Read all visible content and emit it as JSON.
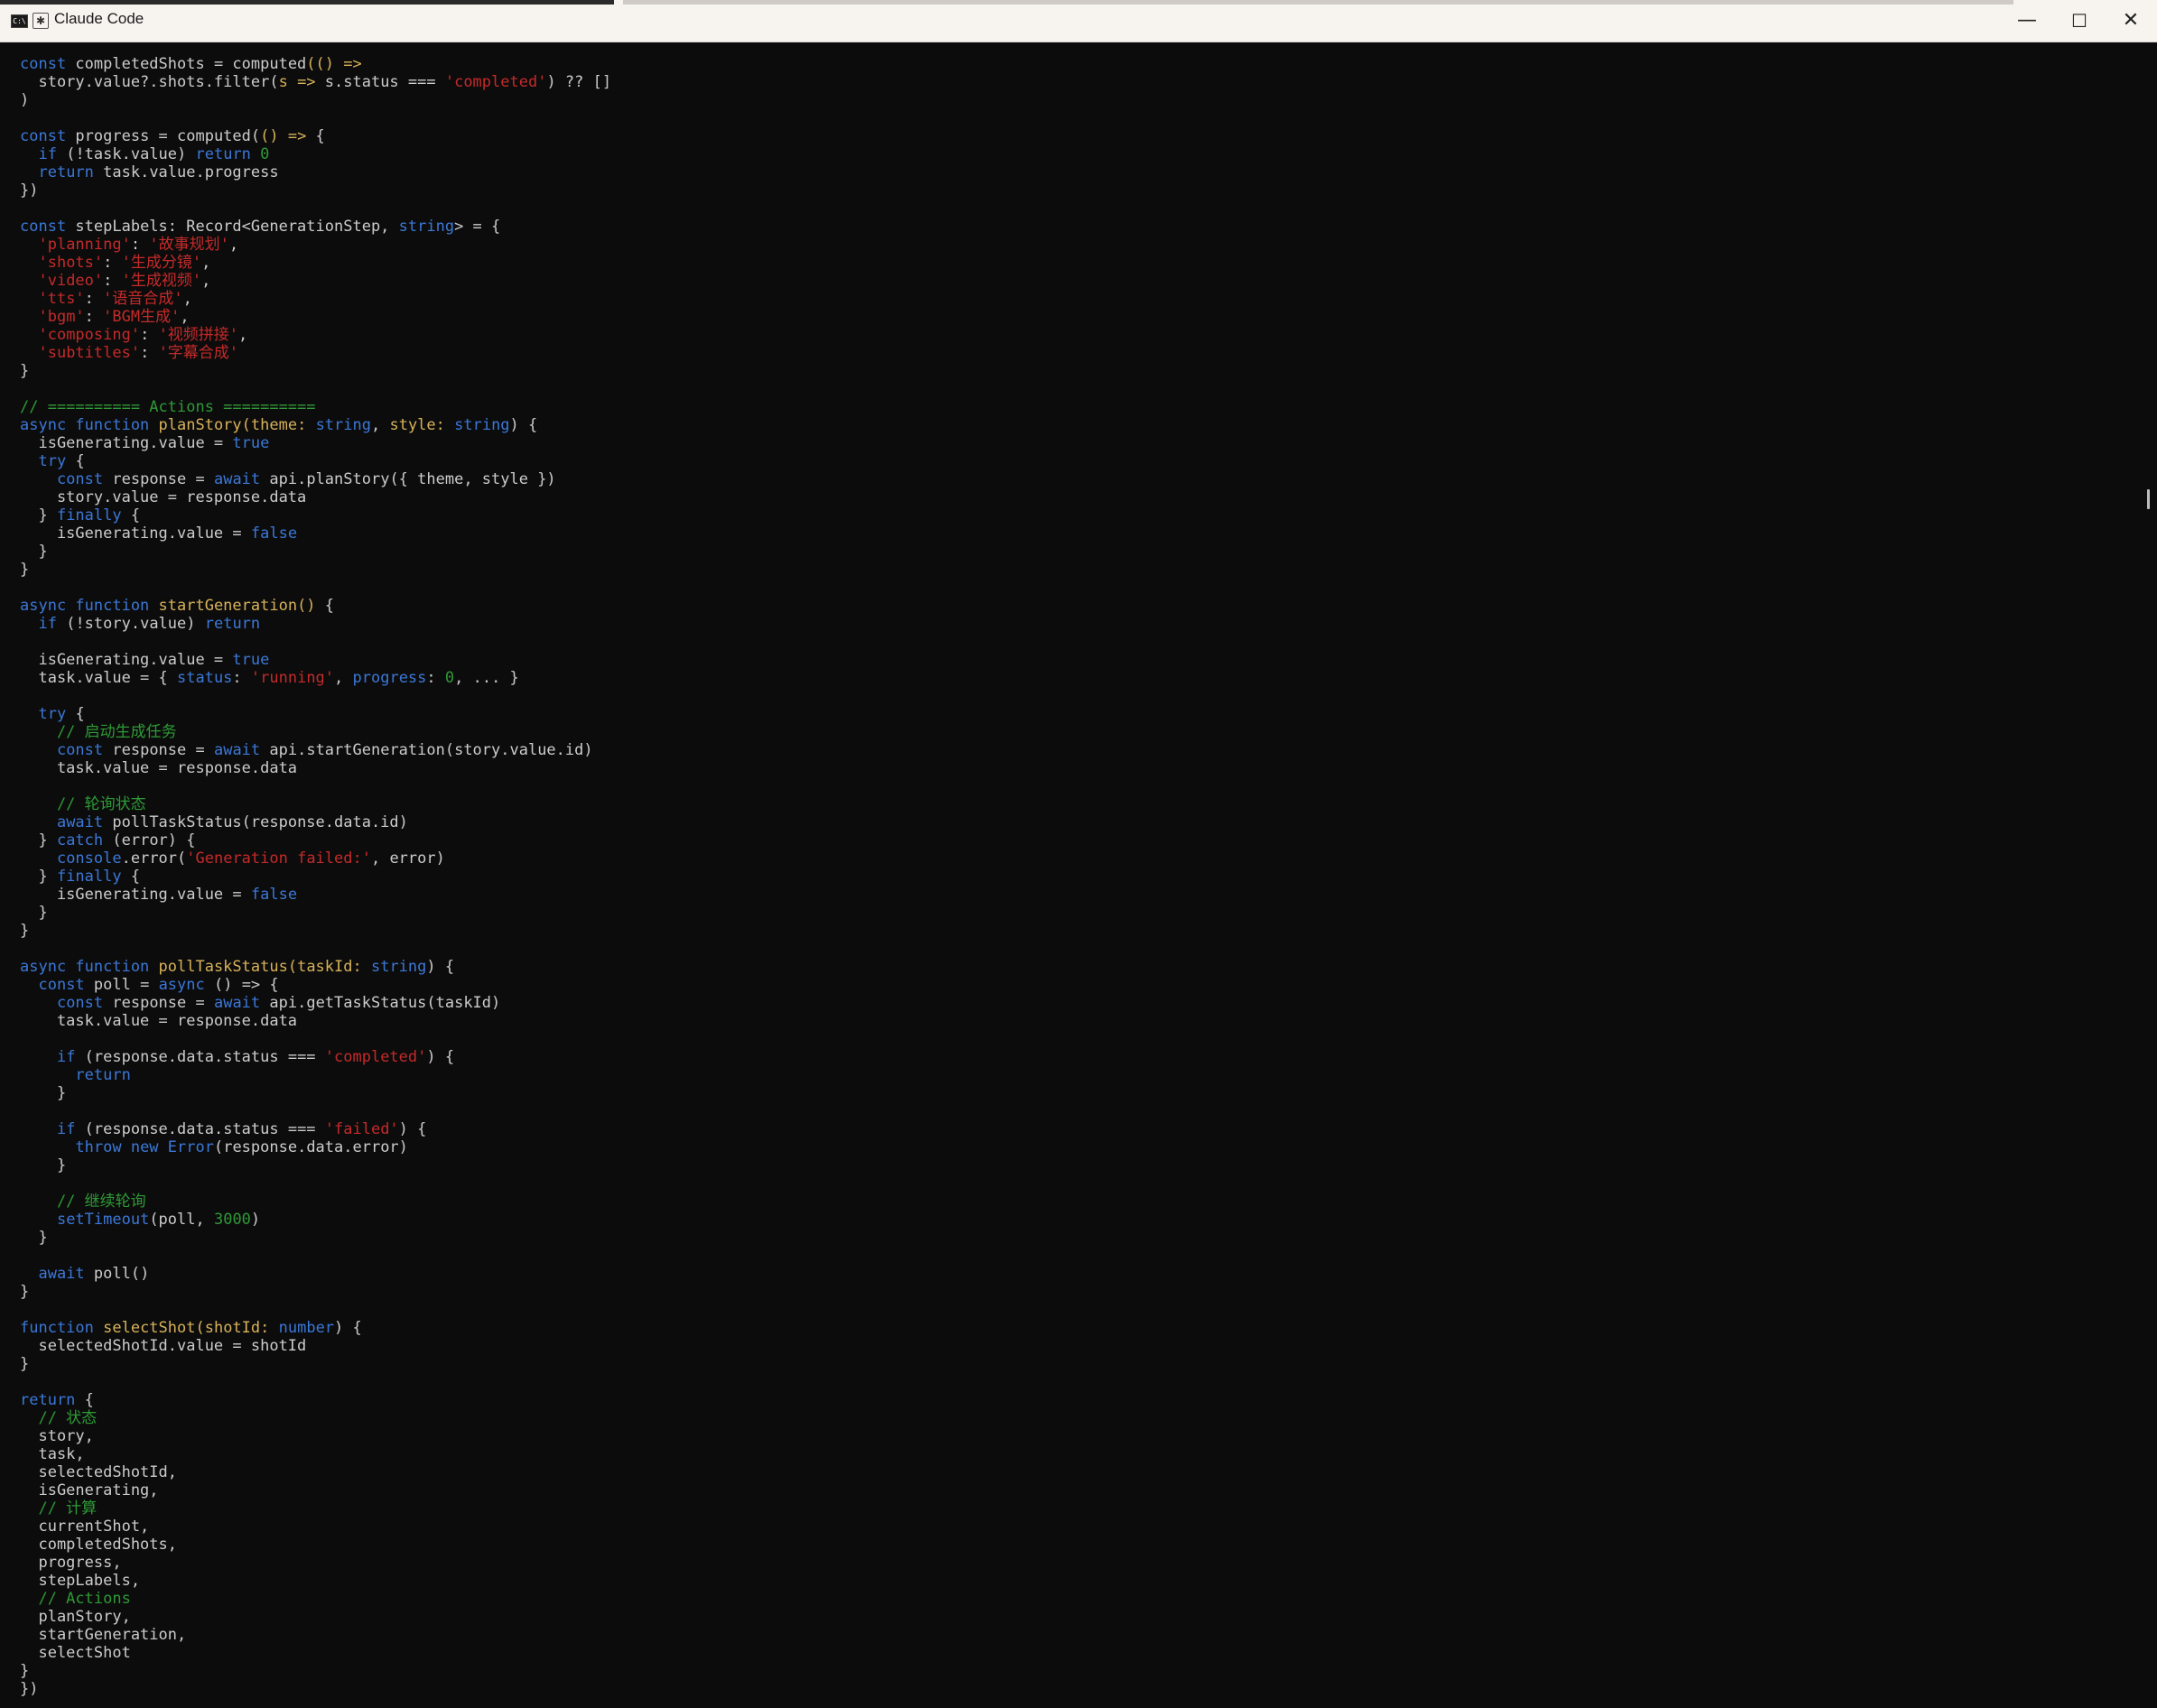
{
  "window": {
    "title": "Claude Code",
    "controls": {
      "minimize": "—",
      "maximize": "☐",
      "close": "✕"
    }
  },
  "icons": {
    "terminal": "terminal-icon",
    "app": "claude-app-icon"
  },
  "colors": {
    "background": "#0c0c0c",
    "text": "#cccccc",
    "keyword": "#3b78d8",
    "string": "#c52a2a",
    "function": "#d8b25a",
    "comment": "#2e9a36"
  },
  "code_lines": [
    [
      {
        "t": "const ",
        "c": "k"
      },
      {
        "t": "completedShots = computed",
        "c": "p"
      },
      {
        "t": "(",
        "c": "f"
      },
      {
        "t": "()",
        "c": "f"
      },
      {
        "t": " =>",
        "c": "f"
      }
    ],
    [
      {
        "t": "  story.value?.shots.filter(",
        "c": "p"
      },
      {
        "t": "s",
        "c": "f"
      },
      {
        "t": " =>",
        "c": "f"
      },
      {
        "t": " s.status === ",
        "c": "p"
      },
      {
        "t": "'completed'",
        "c": "s"
      },
      {
        "t": ") ?? []",
        "c": "p"
      }
    ],
    [
      {
        "t": ")",
        "c": "p"
      }
    ],
    [],
    [
      {
        "t": "const ",
        "c": "k"
      },
      {
        "t": "progress = computed(",
        "c": "p"
      },
      {
        "t": "() =>",
        "c": "f"
      },
      {
        "t": " {",
        "c": "p"
      }
    ],
    [
      {
        "t": "  ",
        "c": "p"
      },
      {
        "t": "if",
        "c": "k"
      },
      {
        "t": " (!task.value) ",
        "c": "p"
      },
      {
        "t": "return",
        "c": "k"
      },
      {
        "t": " ",
        "c": "p"
      },
      {
        "t": "0",
        "c": "n"
      }
    ],
    [
      {
        "t": "  ",
        "c": "p"
      },
      {
        "t": "return",
        "c": "k"
      },
      {
        "t": " task.value.progress",
        "c": "p"
      }
    ],
    [
      {
        "t": "})",
        "c": "p"
      }
    ],
    [],
    [
      {
        "t": "const ",
        "c": "k"
      },
      {
        "t": "stepLabels: Record<GenerationStep, ",
        "c": "p"
      },
      {
        "t": "string",
        "c": "k"
      },
      {
        "t": "> = {",
        "c": "p"
      }
    ],
    [
      {
        "t": "  ",
        "c": "p"
      },
      {
        "t": "'planning'",
        "c": "s"
      },
      {
        "t": ": ",
        "c": "p"
      },
      {
        "t": "'故事规划'",
        "c": "s"
      },
      {
        "t": ",",
        "c": "p"
      }
    ],
    [
      {
        "t": "  ",
        "c": "p"
      },
      {
        "t": "'shots'",
        "c": "s"
      },
      {
        "t": ": ",
        "c": "p"
      },
      {
        "t": "'生成分镜'",
        "c": "s"
      },
      {
        "t": ",",
        "c": "p"
      }
    ],
    [
      {
        "t": "  ",
        "c": "p"
      },
      {
        "t": "'video'",
        "c": "s"
      },
      {
        "t": ": ",
        "c": "p"
      },
      {
        "t": "'生成视频'",
        "c": "s"
      },
      {
        "t": ",",
        "c": "p"
      }
    ],
    [
      {
        "t": "  ",
        "c": "p"
      },
      {
        "t": "'tts'",
        "c": "s"
      },
      {
        "t": ": ",
        "c": "p"
      },
      {
        "t": "'语音合成'",
        "c": "s"
      },
      {
        "t": ",",
        "c": "p"
      }
    ],
    [
      {
        "t": "  ",
        "c": "p"
      },
      {
        "t": "'bgm'",
        "c": "s"
      },
      {
        "t": ": ",
        "c": "p"
      },
      {
        "t": "'BGM生成'",
        "c": "s"
      },
      {
        "t": ",",
        "c": "p"
      }
    ],
    [
      {
        "t": "  ",
        "c": "p"
      },
      {
        "t": "'composing'",
        "c": "s"
      },
      {
        "t": ": ",
        "c": "p"
      },
      {
        "t": "'视频拼接'",
        "c": "s"
      },
      {
        "t": ",",
        "c": "p"
      }
    ],
    [
      {
        "t": "  ",
        "c": "p"
      },
      {
        "t": "'subtitles'",
        "c": "s"
      },
      {
        "t": ": ",
        "c": "p"
      },
      {
        "t": "'字幕合成'",
        "c": "s"
      }
    ],
    [
      {
        "t": "}",
        "c": "p"
      }
    ],
    [],
    [
      {
        "t": "// ========== Actions ==========",
        "c": "c"
      }
    ],
    [
      {
        "t": "async function ",
        "c": "k"
      },
      {
        "t": "planStory",
        "c": "f"
      },
      {
        "t": "(",
        "c": "f"
      },
      {
        "t": "theme: ",
        "c": "f"
      },
      {
        "t": "string",
        "c": "k"
      },
      {
        "t": ", ",
        "c": "p"
      },
      {
        "t": "style: ",
        "c": "f"
      },
      {
        "t": "string",
        "c": "k"
      },
      {
        "t": ") {",
        "c": "p"
      }
    ],
    [
      {
        "t": "  isGenerating.value = ",
        "c": "p"
      },
      {
        "t": "true",
        "c": "k"
      }
    ],
    [
      {
        "t": "  ",
        "c": "p"
      },
      {
        "t": "try",
        "c": "k"
      },
      {
        "t": " {",
        "c": "p"
      }
    ],
    [
      {
        "t": "    ",
        "c": "p"
      },
      {
        "t": "const",
        "c": "k"
      },
      {
        "t": " response = ",
        "c": "p"
      },
      {
        "t": "await",
        "c": "k"
      },
      {
        "t": " api.planStory({ theme, style })",
        "c": "p"
      }
    ],
    [
      {
        "t": "    story.value = response.data",
        "c": "p"
      }
    ],
    [
      {
        "t": "  } ",
        "c": "p"
      },
      {
        "t": "finally",
        "c": "k"
      },
      {
        "t": " {",
        "c": "p"
      }
    ],
    [
      {
        "t": "    isGenerating.value = ",
        "c": "p"
      },
      {
        "t": "false",
        "c": "k"
      }
    ],
    [
      {
        "t": "  }",
        "c": "p"
      }
    ],
    [
      {
        "t": "}",
        "c": "p"
      }
    ],
    [],
    [
      {
        "t": "async function ",
        "c": "k"
      },
      {
        "t": "startGeneration",
        "c": "f"
      },
      {
        "t": "()",
        "c": "f"
      },
      {
        "t": " {",
        "c": "p"
      }
    ],
    [
      {
        "t": "  ",
        "c": "p"
      },
      {
        "t": "if",
        "c": "k"
      },
      {
        "t": " (!story.value) ",
        "c": "p"
      },
      {
        "t": "return",
        "c": "k"
      }
    ],
    [],
    [
      {
        "t": "  isGenerating.value = ",
        "c": "p"
      },
      {
        "t": "true",
        "c": "k"
      }
    ],
    [
      {
        "t": "  task.value = { ",
        "c": "p"
      },
      {
        "t": "status",
        "c": "k"
      },
      {
        "t": ": ",
        "c": "p"
      },
      {
        "t": "'running'",
        "c": "s"
      },
      {
        "t": ", ",
        "c": "p"
      },
      {
        "t": "progress",
        "c": "k"
      },
      {
        "t": ": ",
        "c": "p"
      },
      {
        "t": "0",
        "c": "n"
      },
      {
        "t": ", ... }",
        "c": "p"
      }
    ],
    [],
    [
      {
        "t": "  ",
        "c": "p"
      },
      {
        "t": "try",
        "c": "k"
      },
      {
        "t": " {",
        "c": "p"
      }
    ],
    [
      {
        "t": "    // 启动生成任务",
        "c": "c"
      }
    ],
    [
      {
        "t": "    ",
        "c": "p"
      },
      {
        "t": "const",
        "c": "k"
      },
      {
        "t": " response = ",
        "c": "p"
      },
      {
        "t": "await",
        "c": "k"
      },
      {
        "t": " api.startGeneration(story.value.id)",
        "c": "p"
      }
    ],
    [
      {
        "t": "    task.value = response.data",
        "c": "p"
      }
    ],
    [],
    [
      {
        "t": "    // 轮询状态",
        "c": "c"
      }
    ],
    [
      {
        "t": "    ",
        "c": "p"
      },
      {
        "t": "await",
        "c": "k"
      },
      {
        "t": " pollTaskStatus(response.data.id)",
        "c": "p"
      }
    ],
    [
      {
        "t": "  } ",
        "c": "p"
      },
      {
        "t": "catch",
        "c": "k"
      },
      {
        "t": " (error) {",
        "c": "p"
      }
    ],
    [
      {
        "t": "    ",
        "c": "p"
      },
      {
        "t": "console",
        "c": "k"
      },
      {
        "t": ".error(",
        "c": "p"
      },
      {
        "t": "'Generation failed:'",
        "c": "s"
      },
      {
        "t": ", error)",
        "c": "p"
      }
    ],
    [
      {
        "t": "  } ",
        "c": "p"
      },
      {
        "t": "finally",
        "c": "k"
      },
      {
        "t": " {",
        "c": "p"
      }
    ],
    [
      {
        "t": "    isGenerating.value = ",
        "c": "p"
      },
      {
        "t": "false",
        "c": "k"
      }
    ],
    [
      {
        "t": "  }",
        "c": "p"
      }
    ],
    [
      {
        "t": "}",
        "c": "p"
      }
    ],
    [],
    [
      {
        "t": "async function ",
        "c": "k"
      },
      {
        "t": "pollTaskStatus",
        "c": "f"
      },
      {
        "t": "(",
        "c": "f"
      },
      {
        "t": "taskId: ",
        "c": "f"
      },
      {
        "t": "string",
        "c": "k"
      },
      {
        "t": ") {",
        "c": "p"
      }
    ],
    [
      {
        "t": "  ",
        "c": "p"
      },
      {
        "t": "const",
        "c": "k"
      },
      {
        "t": " poll = ",
        "c": "p"
      },
      {
        "t": "async",
        "c": "k"
      },
      {
        "t": " () => {",
        "c": "p"
      }
    ],
    [
      {
        "t": "    ",
        "c": "p"
      },
      {
        "t": "const",
        "c": "k"
      },
      {
        "t": " response = ",
        "c": "p"
      },
      {
        "t": "await",
        "c": "k"
      },
      {
        "t": " api.getTaskStatus(taskId)",
        "c": "p"
      }
    ],
    [
      {
        "t": "    task.value = response.data",
        "c": "p"
      }
    ],
    [],
    [
      {
        "t": "    ",
        "c": "p"
      },
      {
        "t": "if",
        "c": "k"
      },
      {
        "t": " (response.data.status === ",
        "c": "p"
      },
      {
        "t": "'completed'",
        "c": "s"
      },
      {
        "t": ") {",
        "c": "p"
      }
    ],
    [
      {
        "t": "      ",
        "c": "p"
      },
      {
        "t": "return",
        "c": "k"
      }
    ],
    [
      {
        "t": "    }",
        "c": "p"
      }
    ],
    [],
    [
      {
        "t": "    ",
        "c": "p"
      },
      {
        "t": "if",
        "c": "k"
      },
      {
        "t": " (response.data.status === ",
        "c": "p"
      },
      {
        "t": "'failed'",
        "c": "s"
      },
      {
        "t": ") {",
        "c": "p"
      }
    ],
    [
      {
        "t": "      ",
        "c": "p"
      },
      {
        "t": "throw new ",
        "c": "k"
      },
      {
        "t": "Error",
        "c": "k"
      },
      {
        "t": "(response.data.error)",
        "c": "p"
      }
    ],
    [
      {
        "t": "    }",
        "c": "p"
      }
    ],
    [],
    [
      {
        "t": "    // 继续轮询",
        "c": "c"
      }
    ],
    [
      {
        "t": "    ",
        "c": "p"
      },
      {
        "t": "setTimeout",
        "c": "k"
      },
      {
        "t": "(poll, ",
        "c": "p"
      },
      {
        "t": "3000",
        "c": "n"
      },
      {
        "t": ")",
        "c": "p"
      }
    ],
    [
      {
        "t": "  }",
        "c": "p"
      }
    ],
    [],
    [
      {
        "t": "  ",
        "c": "p"
      },
      {
        "t": "await",
        "c": "k"
      },
      {
        "t": " poll()",
        "c": "p"
      }
    ],
    [
      {
        "t": "}",
        "c": "p"
      }
    ],
    [],
    [
      {
        "t": "function ",
        "c": "k"
      },
      {
        "t": "selectShot",
        "c": "f"
      },
      {
        "t": "(",
        "c": "f"
      },
      {
        "t": "shotId: ",
        "c": "f"
      },
      {
        "t": "number",
        "c": "k"
      },
      {
        "t": ") {",
        "c": "p"
      }
    ],
    [
      {
        "t": "  selectedShotId.value = shotId",
        "c": "p"
      }
    ],
    [
      {
        "t": "}",
        "c": "p"
      }
    ],
    [],
    [
      {
        "t": "return",
        "c": "k"
      },
      {
        "t": " {",
        "c": "p"
      }
    ],
    [
      {
        "t": "  // 状态",
        "c": "c"
      }
    ],
    [
      {
        "t": "  story,",
        "c": "p"
      }
    ],
    [
      {
        "t": "  task,",
        "c": "p"
      }
    ],
    [
      {
        "t": "  selectedShotId,",
        "c": "p"
      }
    ],
    [
      {
        "t": "  isGenerating,",
        "c": "p"
      }
    ],
    [
      {
        "t": "  // 计算",
        "c": "c"
      }
    ],
    [
      {
        "t": "  currentShot,",
        "c": "p"
      }
    ],
    [
      {
        "t": "  completedShots,",
        "c": "p"
      }
    ],
    [
      {
        "t": "  progress,",
        "c": "p"
      }
    ],
    [
      {
        "t": "  stepLabels,",
        "c": "p"
      }
    ],
    [
      {
        "t": "  // Actions",
        "c": "c"
      }
    ],
    [
      {
        "t": "  planStory,",
        "c": "p"
      }
    ],
    [
      {
        "t": "  startGeneration,",
        "c": "p"
      }
    ],
    [
      {
        "t": "  selectShot",
        "c": "p"
      }
    ],
    [
      {
        "t": "}",
        "c": "p"
      }
    ],
    [
      {
        "t": "})",
        "c": "p"
      }
    ]
  ]
}
